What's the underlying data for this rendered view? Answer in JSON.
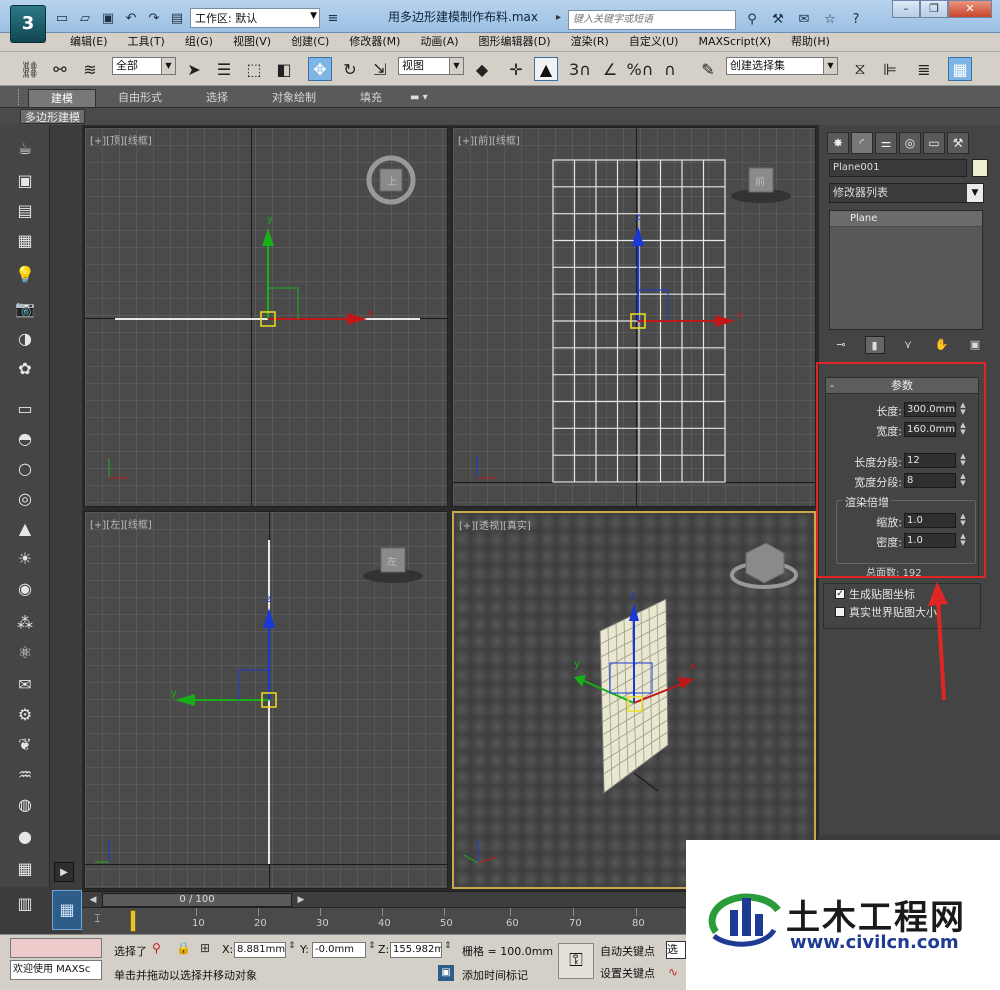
{
  "title_bar": {
    "logo_text": "3",
    "workspace_label": "工作区: 默认",
    "document_title": "用多边形建模制作布料.max",
    "search_placeholder": "键入关键字或短语",
    "window_controls": [
      "minimize-icon",
      "restore-icon",
      "close-icon"
    ]
  },
  "menu": [
    "编辑(E)",
    "工具(T)",
    "组(G)",
    "视图(V)",
    "创建(C)",
    "修改器(M)",
    "动画(A)",
    "图形编辑器(D)",
    "渲染(R)",
    "自定义(U)",
    "MAXScript(X)",
    "帮助(H)"
  ],
  "toolbar": {
    "selection_filter": "全部",
    "reference_coord": "视图",
    "snap_labels": [
      "3",
      "%"
    ],
    "named_selection": "创建选择集"
  },
  "ribbon": {
    "tabs": [
      "建模",
      "自由形式",
      "选择",
      "对象绘制",
      "填充"
    ],
    "active_tab": "建模",
    "sub_label": "多边形建模"
  },
  "viewports": {
    "top": {
      "label": "[+][顶][线框]",
      "cube_label": "上"
    },
    "front": {
      "label": "[+][前][线框]",
      "cube_label": "前"
    },
    "left": {
      "label": "[+][左][线框]",
      "cube_label": "左"
    },
    "perspective": {
      "label": "[+][透视][真实]"
    },
    "axis_labels": {
      "x": "x",
      "y": "y",
      "z": "z"
    }
  },
  "command_panel": {
    "object_name": "Plane001",
    "object_color": "#eef0cf",
    "modifier_list": "修改器列表",
    "stack_items": [
      "Plane"
    ],
    "params": {
      "header": "参数",
      "collapse_symbol": "-",
      "length_label": "长度:",
      "length_value": "300.0mm",
      "width_label": "宽度:",
      "width_value": "160.0mm",
      "length_segs_label": "长度分段:",
      "length_segs_value": "12",
      "width_segs_label": "宽度分段:",
      "width_segs_value": "8",
      "render_group_title": "渲染倍增",
      "scale_label": "缩放:",
      "scale_value": "1.0",
      "density_label": "密度:",
      "density_value": "1.0",
      "total_faces_label": "总面数:",
      "total_faces_value": "192"
    },
    "gen_mapping_coords": {
      "label": "生成贴图坐标",
      "checked": true
    },
    "real_world_map": {
      "label": "真实世界贴图大小",
      "checked": false
    },
    "highlight_color": "#e02525"
  },
  "timeline": {
    "slider_text": "0 / 100",
    "ticks": [
      "10",
      "20",
      "30",
      "40",
      "50",
      "60",
      "70",
      "80"
    ]
  },
  "status": {
    "maxscript_text": "欢迎使用 MAXSc",
    "selection_label": "选择了",
    "x_label": "X:",
    "x_value": "8.881mm",
    "y_label": "Y:",
    "y_value": "-0.0mm",
    "z_label": "Z:",
    "z_value": "155.982mm",
    "grid_label": "栅格 = 100.0mm",
    "prompt": "单击并拖动以选择并移动对象",
    "add_time_tag": "添加时间标记",
    "auto_key": "自动关键点",
    "set_key": "设置关键点",
    "sel_dropdown": "选"
  },
  "watermark": {
    "cn": "土木工程网",
    "url": "www.civilcn.com"
  }
}
